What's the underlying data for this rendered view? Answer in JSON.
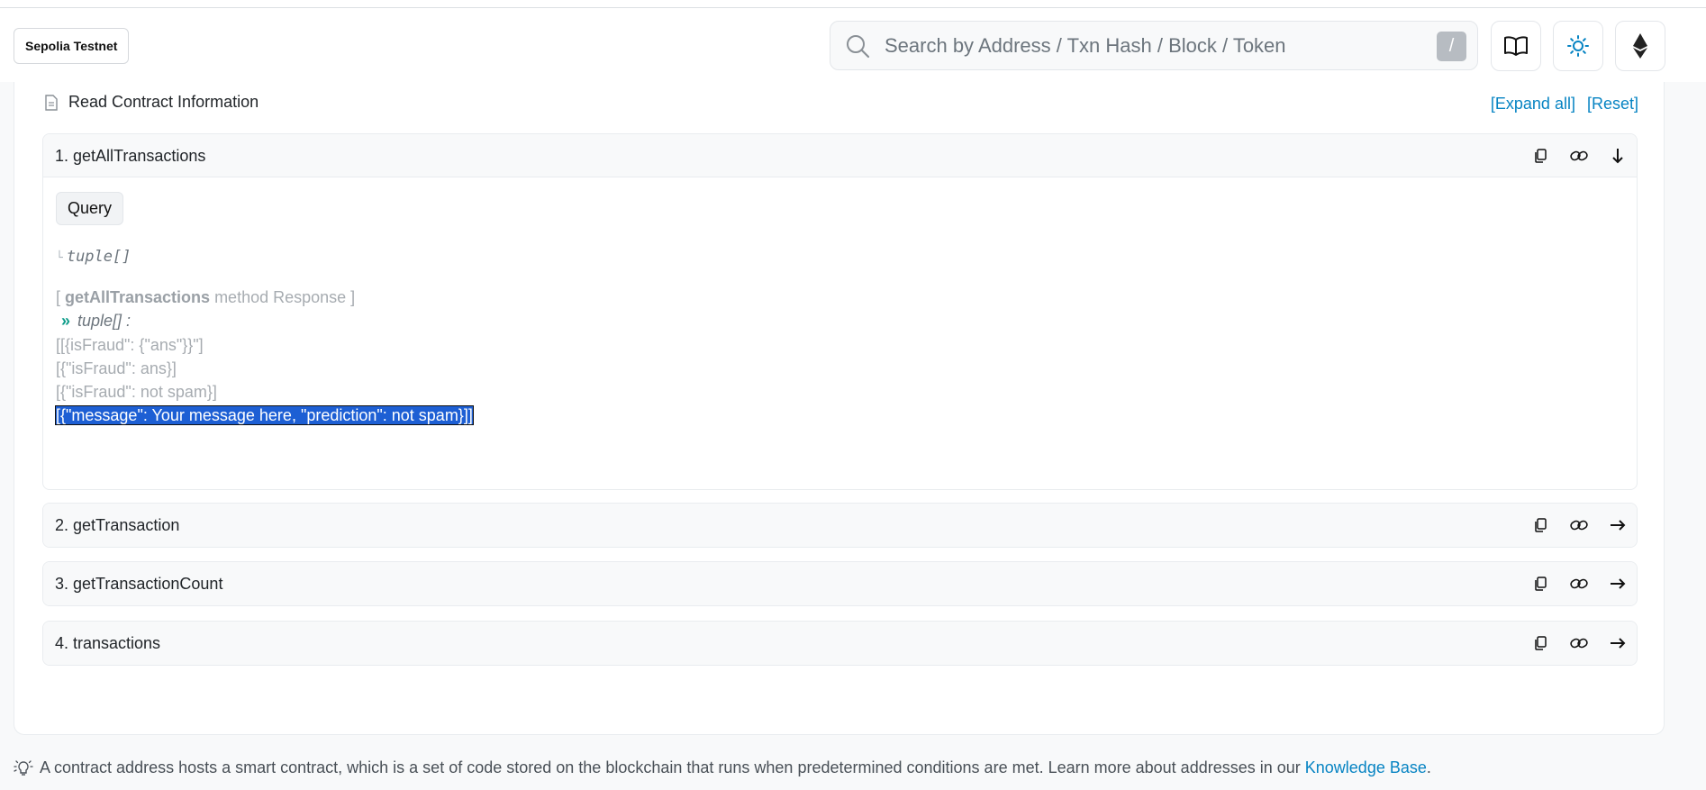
{
  "header": {
    "network": "Sepolia Testnet",
    "search_placeholder": "Search by Address / Txn Hash / Block / Token",
    "search_shortcut": "/"
  },
  "section": {
    "title": "Read Contract Information",
    "expand_all": "[Expand all]",
    "reset": "[Reset]"
  },
  "methods": [
    {
      "label": "1. getAllTransactions",
      "expanded": true,
      "query_label": "Query",
      "output_type": "tuple[]",
      "response_prefix": "[ ",
      "response_method": "getAllTransactions",
      "response_suffix": " method Response ]",
      "response_type": "tuple[] :",
      "results": [
        "[[{isFraud\": {\"ans\"}}\"]",
        "[{\"isFraud\": ans}]",
        "[{\"isFraud\": not spam}]",
        "[{\"message\": Your message here, \"prediction\": not spam}]]"
      ]
    },
    {
      "label": "2. getTransaction",
      "expanded": false
    },
    {
      "label": "3. getTransactionCount",
      "expanded": false
    },
    {
      "label": "4. transactions",
      "expanded": false
    }
  ],
  "footer": {
    "text": "A contract address hosts a smart contract, which is a set of code stored on the blockchain that runs when predetermined conditions are met. Learn more about addresses in our ",
    "link": "Knowledge Base",
    "end": "."
  },
  "colors": {
    "link": "#0784c3",
    "accent_teal": "#0f9d8a",
    "selection": "#1d5fd4"
  }
}
